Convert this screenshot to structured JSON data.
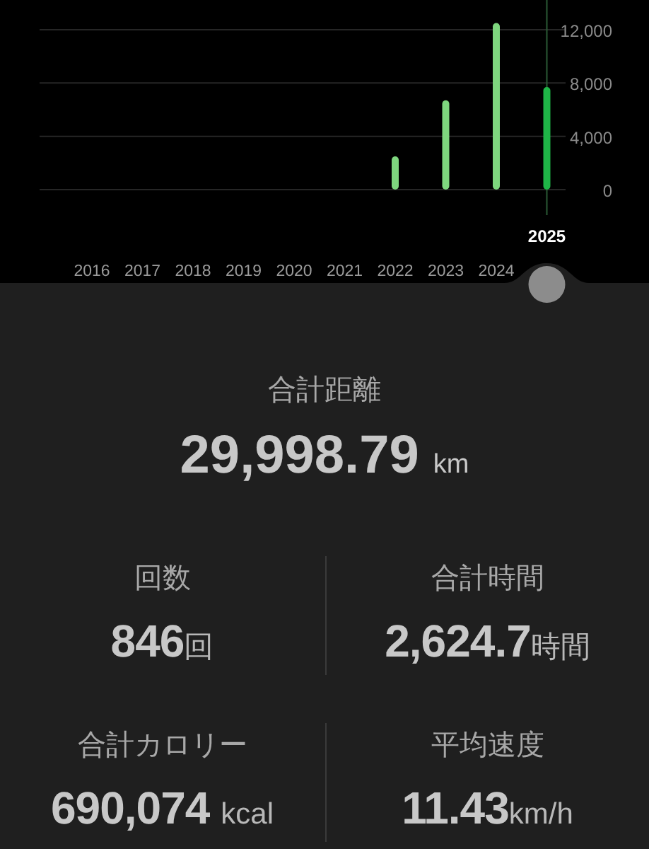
{
  "chart_data": {
    "type": "bar",
    "categories": [
      "2016",
      "2017",
      "2018",
      "2019",
      "2020",
      "2021",
      "2022",
      "2023",
      "2024",
      "2025"
    ],
    "series": [
      {
        "color": "#7ed67e",
        "values": [
          0,
          0,
          0,
          0,
          0,
          0,
          2500,
          6700,
          12500,
          null
        ]
      },
      {
        "color": "#1fb547",
        "values": [
          null,
          null,
          null,
          null,
          null,
          null,
          null,
          null,
          null,
          7700
        ]
      }
    ],
    "grid": true,
    "ylim": [
      0,
      14230
    ],
    "yticks": [
      {
        "value": 0,
        "label": "0"
      },
      {
        "value": 4000,
        "label": "4,000"
      },
      {
        "value": 8000,
        "label": "8,000"
      },
      {
        "value": 12000,
        "label": "12,000"
      }
    ]
  },
  "year_states": [
    {
      "selected": false
    },
    {
      "selected": false
    },
    {
      "selected": false
    },
    {
      "selected": false
    },
    {
      "selected": false
    },
    {
      "selected": false
    },
    {
      "selected": false
    },
    {
      "selected": false
    },
    {
      "selected": false
    },
    {
      "selected": true
    }
  ],
  "total_distance": {
    "label": "合計距離",
    "value": "29,998.79",
    "unit": "km"
  },
  "stats": [
    {
      "label": "回数",
      "value": "846",
      "unit": "回"
    },
    {
      "label": "合計時間",
      "value": "2,624.7",
      "unit": "時間"
    },
    {
      "label": "合計カロリー",
      "value": "690,074",
      "unit": "kcal"
    },
    {
      "label": "平均速度",
      "value": "11.43",
      "unit": "km/h"
    }
  ]
}
